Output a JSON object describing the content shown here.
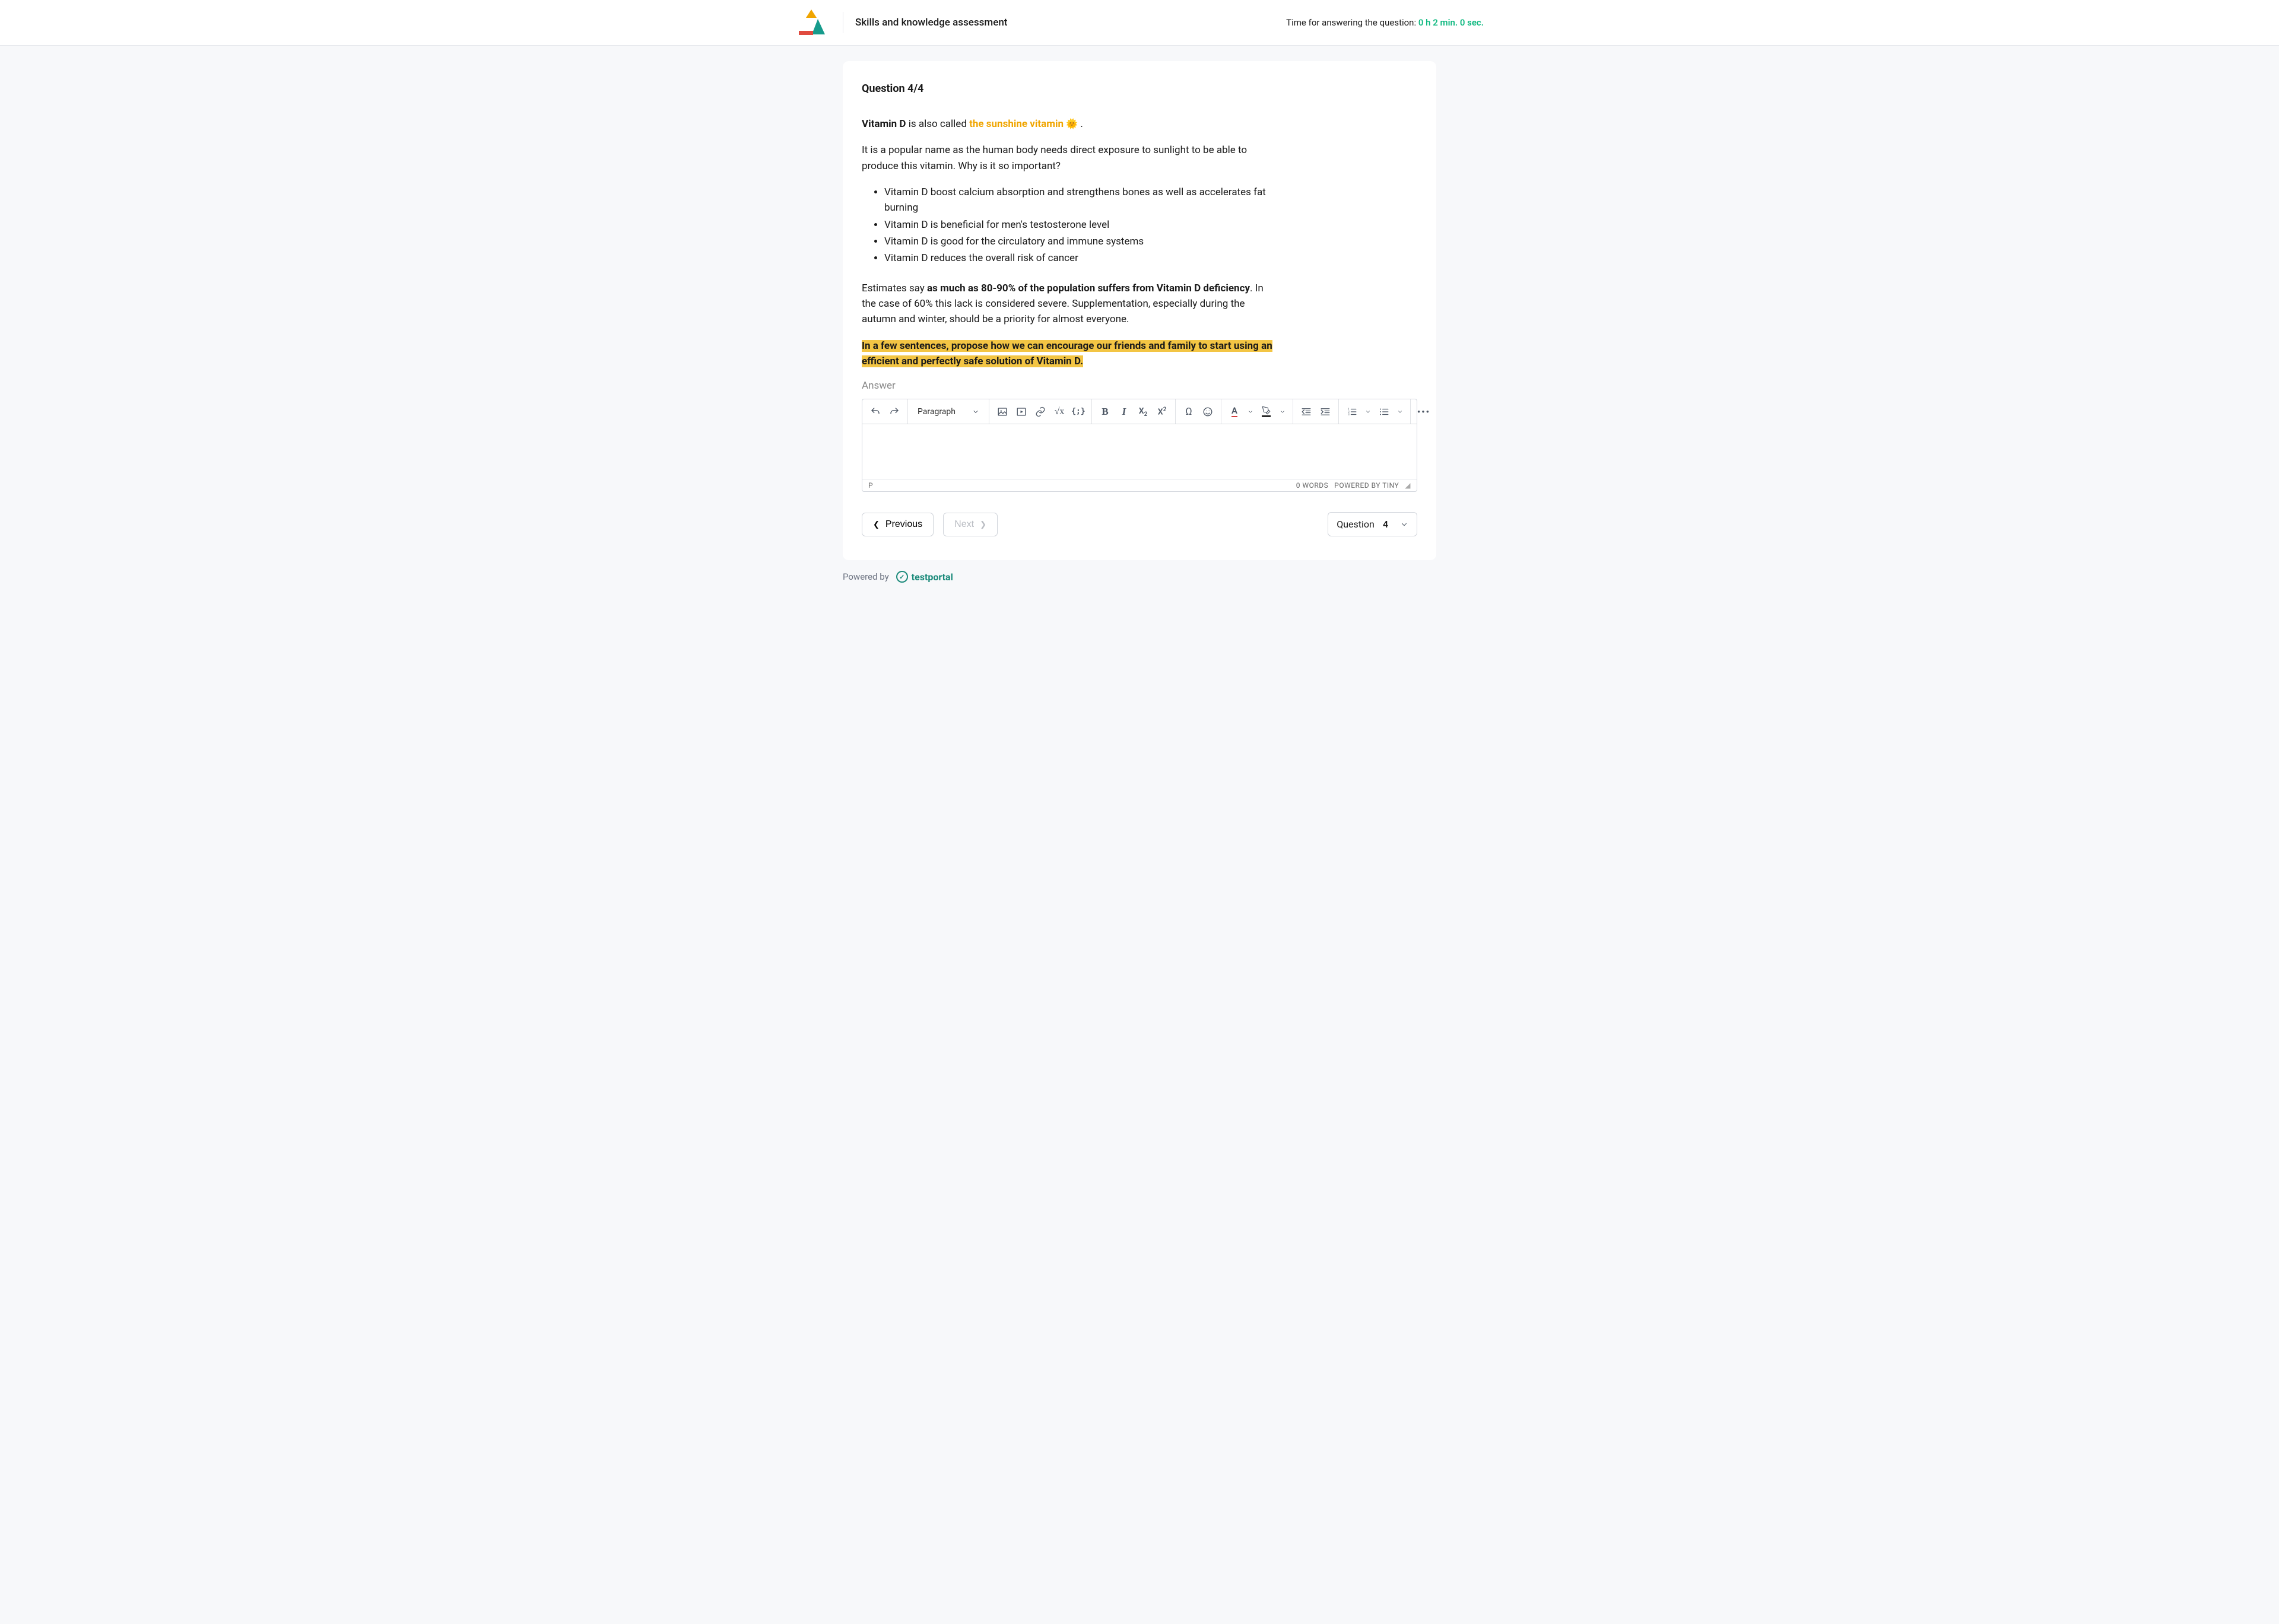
{
  "header": {
    "title": "Skills and knowledge assessment",
    "timer_label": "Time for answering the question:",
    "timer_value": "0 h 2 min. 0 sec."
  },
  "question": {
    "counter": "Question 4/4",
    "intro_strong": "Vitamin D",
    "intro_mid": " is also called ",
    "intro_sunshine": "the sunshine vitamin ",
    "intro_emoji": "🌞",
    "intro_end": " .",
    "p2": "It is a popular name as the human body needs direct exposure to sunlight to be able to produce this vitamin. Why is it so important?",
    "bullets": [
      "Vitamin D boost calcium absorption and strengthens bones as well as accelerates fat burning",
      "Vitamin D is beneficial for men's testosterone level",
      "Vitamin D is good for the circulatory and immune systems",
      "Vitamin D reduces the overall risk of cancer"
    ],
    "p3_a": "Estimates say ",
    "p3_b": "as much as 80-90% of the population suffers from Vitamin D deficiency",
    "p3_c": ". In the case of 60% this lack is considered severe. Supplementation, especially during the autumn and winter, should be a priority for almost everyone.",
    "highlight": "In a few sentences, propose how we can encourage our friends and family to start using an efficient and perfectly safe solution of Vitamin D.",
    "answer_label": "Answer"
  },
  "editor": {
    "format_select": "Paragraph",
    "path": "P",
    "words": "0 WORDS",
    "powered": "POWERED BY TINY"
  },
  "nav": {
    "prev": "Previous",
    "next": "Next",
    "selector_label": "Question",
    "selector_value": "4"
  },
  "footer": {
    "powered": "Powered by",
    "brand": "testportal"
  }
}
